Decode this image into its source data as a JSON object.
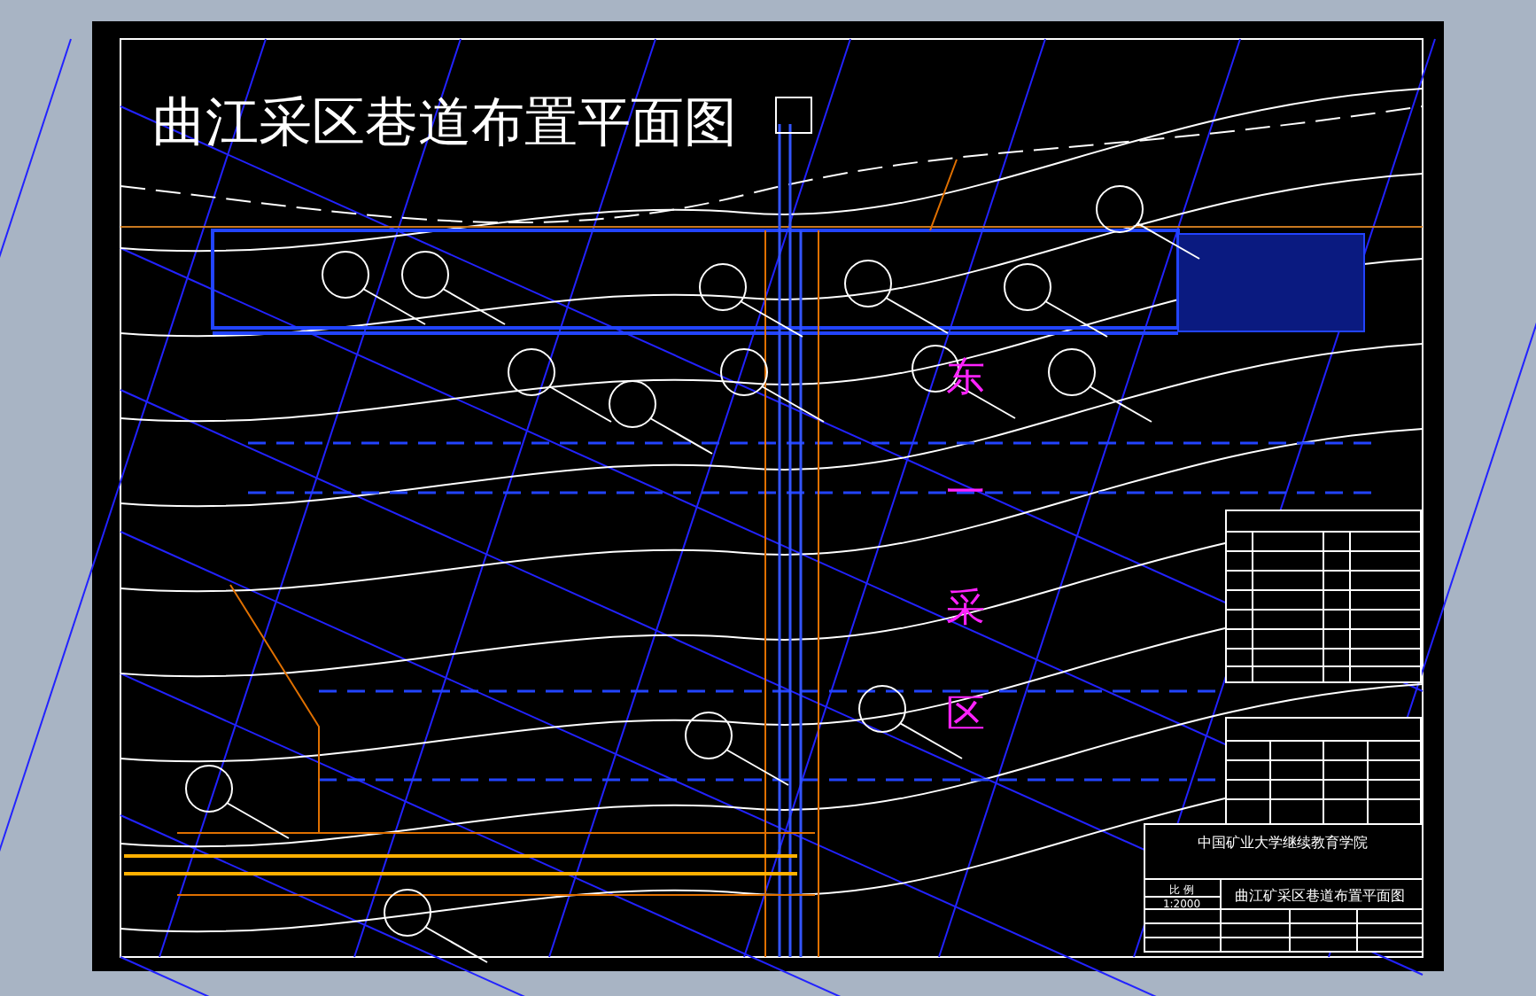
{
  "drawing": {
    "title": "曲江采区巷道布置平面图",
    "region_label": [
      "东",
      "一",
      "采",
      "区"
    ]
  },
  "title_block": {
    "school": "中国矿业大学继续教育学院",
    "drawing_name": "曲江矿采区巷道布置平面图",
    "scale_label": "比 例",
    "scale": "1:2000"
  }
}
